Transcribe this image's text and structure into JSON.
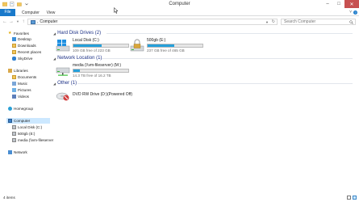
{
  "window": {
    "title": "Computer",
    "minimize_glyph": "–",
    "maximize_glyph": "□",
    "close_glyph": "✕"
  },
  "ribbon": {
    "tabs": [
      {
        "label": "File"
      },
      {
        "label": "Computer"
      },
      {
        "label": "View"
      }
    ],
    "expand_glyph": "˅",
    "help_glyph": "?"
  },
  "address_bar": {
    "path": "Computer",
    "separator": "›"
  },
  "search": {
    "placeholder": "Search Computer"
  },
  "nav_pane": {
    "favorites": {
      "label": "Favorites",
      "items": [
        {
          "label": "Desktop",
          "icon": "desktop-icon"
        },
        {
          "label": "Downloads",
          "icon": "downloads-icon"
        },
        {
          "label": "Recent places",
          "icon": "recent-places-icon"
        },
        {
          "label": "SkyDrive",
          "icon": "skydrive-icon"
        }
      ]
    },
    "libraries": {
      "label": "Libraries",
      "items": [
        {
          "label": "Documents",
          "icon": "documents-icon"
        },
        {
          "label": "Music",
          "icon": "music-icon"
        },
        {
          "label": "Pictures",
          "icon": "pictures-icon"
        },
        {
          "label": "Videos",
          "icon": "videos-icon"
        }
      ]
    },
    "homegroup": {
      "label": "Homegroup"
    },
    "computer": {
      "label": "Computer",
      "items": [
        {
          "label": "Local Disk (C:)",
          "icon": "local-disk-icon"
        },
        {
          "label": "500gb (E:)",
          "icon": "drive-icon"
        },
        {
          "label": "media (\\\\vm-fileserver",
          "icon": "network-drive-icon"
        }
      ]
    },
    "network": {
      "label": "Network"
    }
  },
  "groups": {
    "hard_disk_drives": {
      "label": "Hard Disk Drives (2)",
      "drives": [
        {
          "name": "Local Disk (C:)",
          "free_text": "109 GB free of 223 GB",
          "used_fraction": 0.51,
          "icon": "windows-drive-icon"
        },
        {
          "name": "500gb (E:)",
          "free_text": "237 GB free of 465 GB",
          "used_fraction": 0.49,
          "icon": "locked-drive-icon"
        }
      ]
    },
    "network_location": {
      "label": "Network Location (1)",
      "drives": [
        {
          "name": "media (\\\\vm-fileserver) (M:)",
          "free_text": "14.3 TB free of 16.2 TB",
          "used_fraction": 0.12,
          "icon": "network-drive-icon"
        }
      ]
    },
    "other": {
      "label": "Other (1)",
      "drives": [
        {
          "name": "DVD RW Drive (D:)(Powered Off)",
          "icon": "dvd-drive-off-icon"
        }
      ]
    }
  },
  "status_bar": {
    "item_count": "4 items"
  },
  "colors": {
    "accent": "#1979ca",
    "bar_fill": "#26a0da",
    "group_header": "#1e3287"
  }
}
